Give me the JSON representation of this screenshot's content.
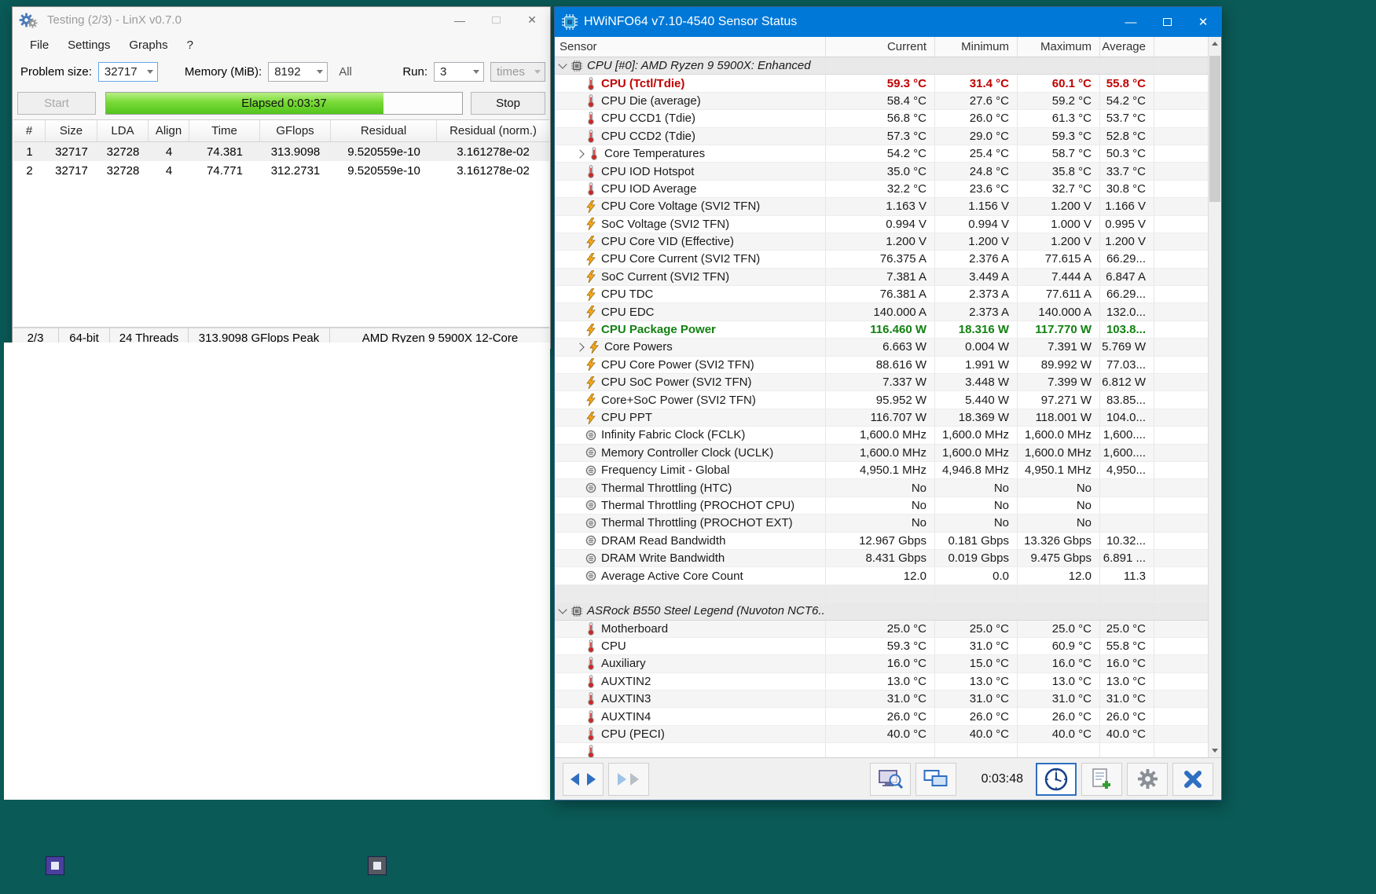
{
  "desktop": {
    "background_color": "#0a5a57"
  },
  "linx_window": {
    "title": "Testing (2/3) - LinX v0.7.0",
    "menu_items": [
      "File",
      "Settings",
      "Graphs",
      "?"
    ],
    "controls": {
      "problem_size_label": "Problem size:",
      "problem_size_value": "32717",
      "memory_label": "Memory (MiB):",
      "memory_value": "8192",
      "all_label": "All",
      "run_label": "Run:",
      "run_value": "3",
      "times_value": "times"
    },
    "buttons": {
      "start": "Start",
      "stop": "Stop"
    },
    "progress": {
      "label": "Elapsed 0:03:37",
      "percent": 78,
      "fill_color": "#53c41b"
    },
    "results_table": {
      "headers": [
        "#",
        "Size",
        "LDA",
        "Align",
        "Time",
        "GFlops",
        "Residual",
        "Residual (norm.)"
      ],
      "rows": [
        [
          "1",
          "32717",
          "32728",
          "4",
          "74.381",
          "313.9098",
          "9.520559e-10",
          "3.161278e-02"
        ],
        [
          "2",
          "32717",
          "32728",
          "4",
          "74.771",
          "312.2731",
          "9.520559e-10",
          "3.161278e-02"
        ]
      ]
    },
    "status_bar": [
      "2/3",
      "64-bit",
      "24 Threads",
      "313.9098 GFlops Peak",
      "AMD Ryzen 9 5900X 12-Core"
    ]
  },
  "hwinfo_window": {
    "title": "HWiNFO64 v7.10-4540 Sensor Status",
    "title_bar_color": "#0078d7",
    "accent_red": "#c00000",
    "accent_green": "#128112",
    "column_headers": [
      "Sensor",
      "Current",
      "Minimum",
      "Maximum",
      "Average"
    ],
    "sensor_rows": [
      {
        "label": "CPU [#0]: AMD Ryzen 9 5900X: Enhanced",
        "current": "",
        "minimum": "",
        "maximum": "",
        "average": "",
        "icon": "chip-icon",
        "style": "group",
        "chevron": "down"
      },
      {
        "label": "CPU (Tctl/Tdie)",
        "current": "59.3 °C",
        "minimum": "31.4 °C",
        "maximum": "60.1 °C",
        "average": "55.8 °C",
        "icon": "thermometer-icon",
        "style": "red"
      },
      {
        "label": "CPU Die (average)",
        "current": "58.4 °C",
        "minimum": "27.6 °C",
        "maximum": "59.2 °C",
        "average": "54.2 °C",
        "icon": "thermometer-icon"
      },
      {
        "label": "CPU CCD1 (Tdie)",
        "current": "56.8 °C",
        "minimum": "26.0 °C",
        "maximum": "61.3 °C",
        "average": "53.7 °C",
        "icon": "thermometer-icon"
      },
      {
        "label": "CPU CCD2 (Tdie)",
        "current": "57.3 °C",
        "minimum": "29.0 °C",
        "maximum": "59.3 °C",
        "average": "52.8 °C",
        "icon": "thermometer-icon"
      },
      {
        "label": "Core Temperatures",
        "current": "54.2 °C",
        "minimum": "25.4 °C",
        "maximum": "58.7 °C",
        "average": "50.3 °C",
        "icon": "thermometer-icon",
        "chevron": "right"
      },
      {
        "label": "CPU IOD Hotspot",
        "current": "35.0 °C",
        "minimum": "24.8 °C",
        "maximum": "35.8 °C",
        "average": "33.7 °C",
        "icon": "thermometer-icon"
      },
      {
        "label": "CPU IOD Average",
        "current": "32.2 °C",
        "minimum": "23.6 °C",
        "maximum": "32.7 °C",
        "average": "30.8 °C",
        "icon": "thermometer-icon"
      },
      {
        "label": "CPU Core Voltage (SVI2 TFN)",
        "current": "1.163 V",
        "minimum": "1.156 V",
        "maximum": "1.200 V",
        "average": "1.166 V",
        "icon": "lightning-icon"
      },
      {
        "label": "SoC Voltage (SVI2 TFN)",
        "current": "0.994 V",
        "minimum": "0.994 V",
        "maximum": "1.000 V",
        "average": "0.995 V",
        "icon": "lightning-icon"
      },
      {
        "label": "CPU Core VID (Effective)",
        "current": "1.200 V",
        "minimum": "1.200 V",
        "maximum": "1.200 V",
        "average": "1.200 V",
        "icon": "lightning-icon"
      },
      {
        "label": "CPU Core Current (SVI2 TFN)",
        "current": "76.375 A",
        "minimum": "2.376 A",
        "maximum": "77.615 A",
        "average": "66.29...",
        "icon": "lightning-icon"
      },
      {
        "label": "SoC Current (SVI2 TFN)",
        "current": "7.381 A",
        "minimum": "3.449 A",
        "maximum": "7.444 A",
        "average": "6.847 A",
        "icon": "lightning-icon"
      },
      {
        "label": "CPU TDC",
        "current": "76.381 A",
        "minimum": "2.373 A",
        "maximum": "77.611 A",
        "average": "66.29...",
        "icon": "lightning-icon"
      },
      {
        "label": "CPU EDC",
        "current": "140.000 A",
        "minimum": "2.373 A",
        "maximum": "140.000 A",
        "average": "132.0...",
        "icon": "lightning-icon"
      },
      {
        "label": "CPU Package Power",
        "current": "116.460 W",
        "minimum": "18.316 W",
        "maximum": "117.770 W",
        "average": "103.8...",
        "icon": "lightning-icon",
        "style": "green"
      },
      {
        "label": "Core Powers",
        "current": "6.663 W",
        "minimum": "0.004 W",
        "maximum": "7.391 W",
        "average": "5.769 W",
        "icon": "lightning-icon",
        "chevron": "right"
      },
      {
        "label": "CPU Core Power (SVI2 TFN)",
        "current": "88.616 W",
        "minimum": "1.991 W",
        "maximum": "89.992 W",
        "average": "77.03...",
        "icon": "lightning-icon"
      },
      {
        "label": "CPU SoC Power (SVI2 TFN)",
        "current": "7.337 W",
        "minimum": "3.448 W",
        "maximum": "7.399 W",
        "average": "6.812 W",
        "icon": "lightning-icon"
      },
      {
        "label": "Core+SoC Power (SVI2 TFN)",
        "current": "95.952 W",
        "minimum": "5.440 W",
        "maximum": "97.271 W",
        "average": "83.85...",
        "icon": "lightning-icon"
      },
      {
        "label": "CPU PPT",
        "current": "116.707 W",
        "minimum": "18.369 W",
        "maximum": "118.001 W",
        "average": "104.0...",
        "icon": "lightning-icon"
      },
      {
        "label": "Infinity Fabric Clock (FCLK)",
        "current": "1,600.0 MHz",
        "minimum": "1,600.0 MHz",
        "maximum": "1,600.0 MHz",
        "average": "1,600....",
        "icon": "gauge-icon"
      },
      {
        "label": "Memory Controller Clock (UCLK)",
        "current": "1,600.0 MHz",
        "minimum": "1,600.0 MHz",
        "maximum": "1,600.0 MHz",
        "average": "1,600....",
        "icon": "gauge-icon"
      },
      {
        "label": "Frequency Limit - Global",
        "current": "4,950.1 MHz",
        "minimum": "4,946.8 MHz",
        "maximum": "4,950.1 MHz",
        "average": "4,950...",
        "icon": "gauge-icon"
      },
      {
        "label": "Thermal Throttling (HTC)",
        "current": "No",
        "minimum": "No",
        "maximum": "No",
        "average": "",
        "icon": "gauge-icon"
      },
      {
        "label": "Thermal Throttling (PROCHOT CPU)",
        "current": "No",
        "minimum": "No",
        "maximum": "No",
        "average": "",
        "icon": "gauge-icon"
      },
      {
        "label": "Thermal Throttling (PROCHOT EXT)",
        "current": "No",
        "minimum": "No",
        "maximum": "No",
        "average": "",
        "icon": "gauge-icon"
      },
      {
        "label": "DRAM Read Bandwidth",
        "current": "12.967 Gbps",
        "minimum": "0.181 Gbps",
        "maximum": "13.326 Gbps",
        "average": "10.32...",
        "icon": "gauge-icon"
      },
      {
        "label": "DRAM Write Bandwidth",
        "current": "8.431 Gbps",
        "minimum": "0.019 Gbps",
        "maximum": "9.475 Gbps",
        "average": "6.891 ...",
        "icon": "gauge-icon"
      },
      {
        "label": "Average Active Core Count",
        "current": "12.0",
        "minimum": "0.0",
        "maximum": "12.0",
        "average": "11.3",
        "icon": "gauge-icon"
      },
      {
        "label": "",
        "current": "",
        "minimum": "",
        "maximum": "",
        "average": "",
        "style": "blank"
      },
      {
        "label": "ASRock B550 Steel Legend (Nuvoton NCT6...",
        "current": "",
        "minimum": "",
        "maximum": "",
        "average": "",
        "icon": "chip-icon",
        "style": "group",
        "chevron": "down"
      },
      {
        "label": "Motherboard",
        "current": "25.0 °C",
        "minimum": "25.0 °C",
        "maximum": "25.0 °C",
        "average": "25.0 °C",
        "icon": "thermometer-icon"
      },
      {
        "label": "CPU",
        "current": "59.3 °C",
        "minimum": "31.0 °C",
        "maximum": "60.9 °C",
        "average": "55.8 °C",
        "icon": "thermometer-icon"
      },
      {
        "label": "Auxiliary",
        "current": "16.0 °C",
        "minimum": "15.0 °C",
        "maximum": "16.0 °C",
        "average": "16.0 °C",
        "icon": "thermometer-icon"
      },
      {
        "label": "AUXTIN2",
        "current": "13.0 °C",
        "minimum": "13.0 °C",
        "maximum": "13.0 °C",
        "average": "13.0 °C",
        "icon": "thermometer-icon"
      },
      {
        "label": "AUXTIN3",
        "current": "31.0 °C",
        "minimum": "31.0 °C",
        "maximum": "31.0 °C",
        "average": "31.0 °C",
        "icon": "thermometer-icon"
      },
      {
        "label": "AUXTIN4",
        "current": "26.0 °C",
        "minimum": "26.0 °C",
        "maximum": "26.0 °C",
        "average": "26.0 °C",
        "icon": "thermometer-icon"
      },
      {
        "label": "CPU (PECI)",
        "current": "40.0 °C",
        "minimum": "40.0 °C",
        "maximum": "40.0 °C",
        "average": "40.0 °C",
        "icon": "thermometer-icon"
      },
      {
        "label": "",
        "current": "",
        "minimum": "",
        "maximum": "",
        "average": "",
        "icon": "thermometer-icon"
      }
    ],
    "toolbar": {
      "elapsed_time": "0:03:48"
    }
  }
}
